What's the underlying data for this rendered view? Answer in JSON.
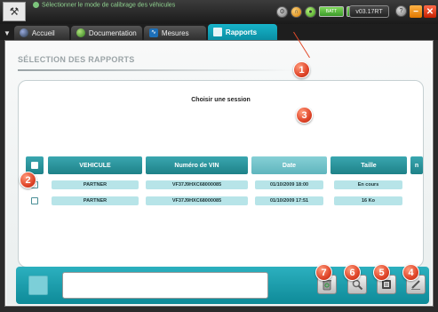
{
  "titlebar": {
    "title": "Sélectionner le mode de calibrage des véhicules",
    "version": "v03.17RT",
    "battery_label": "BATT"
  },
  "tabs": [
    {
      "label": "Accueil",
      "icon": "home-icon"
    },
    {
      "label": "Documentation",
      "icon": "book-icon"
    },
    {
      "label": "Mesures",
      "icon": "waveform-icon"
    },
    {
      "label": "Rapports",
      "icon": "report-icon",
      "active": true
    }
  ],
  "page": {
    "section_title": "SÉLECTION DES RAPPORTS",
    "session_title": "Choisir une session"
  },
  "table": {
    "headers": {
      "vehicle": "VEHICULE",
      "vin": "Numéro de VIN",
      "date": "Date",
      "size": "Taille",
      "extra": "n"
    },
    "rows": [
      {
        "vehicle": "PARTNER",
        "vin": "VF37J9HXC68000085",
        "date": "01/10/2009 18:00",
        "size": "En cours"
      },
      {
        "vehicle": "PARTNER",
        "vin": "VF37J9HXC68000085",
        "date": "01/10/2009 17:51",
        "size": "16 Ko"
      }
    ]
  },
  "bottom": {
    "message": ""
  },
  "callouts": [
    "1",
    "2",
    "3",
    "4",
    "5",
    "6",
    "7"
  ],
  "colors": {
    "accent": "#17b3c9",
    "header": "#2a959d",
    "cell": "#b7e4e8",
    "callout": "#e0462a"
  }
}
